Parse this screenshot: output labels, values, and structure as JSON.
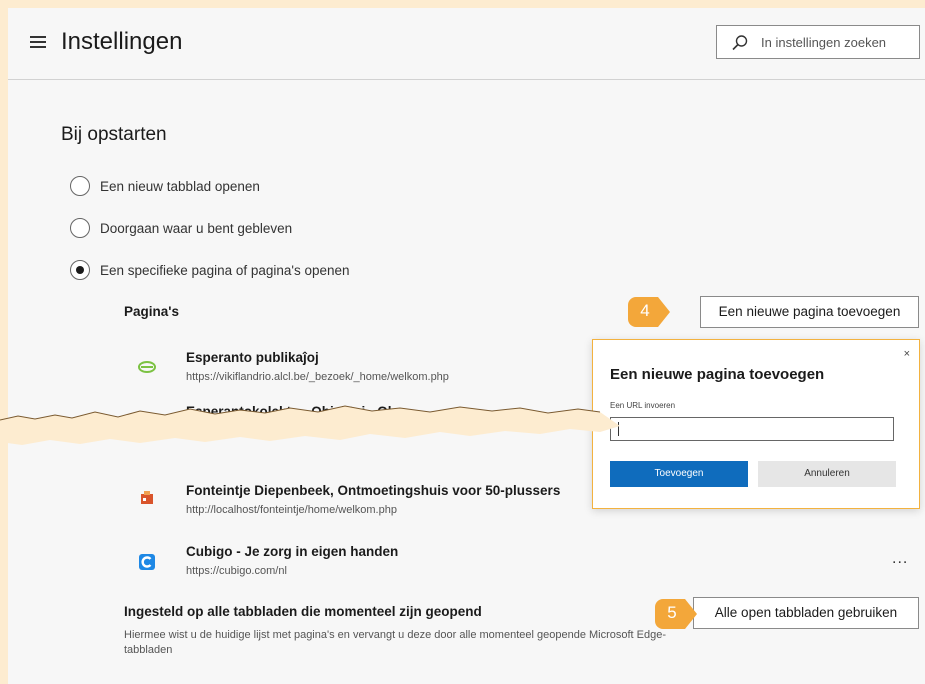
{
  "header": {
    "title": "Instellingen",
    "search_placeholder": "In instellingen zoeken"
  },
  "startup": {
    "heading": "Bij opstarten",
    "options": [
      {
        "label": "Een nieuw tabblad openen",
        "checked": false
      },
      {
        "label": "Doorgaan waar u bent gebleven",
        "checked": false
      },
      {
        "label": "Een specifieke pagina of pagina's openen",
        "checked": true
      }
    ],
    "pages_label": "Pagina's",
    "add_page_button": "Een nieuwe pagina toevoegen",
    "pages": [
      {
        "title": "Esperanto publikaĵoj",
        "url": "https://vikiflandrio.alcl.be/_bezoek/_home/welkom.php",
        "icon": "esperanto-green-icon"
      },
      {
        "title": "Esperantokolekto - Objektoj - Ob",
        "url": "",
        "icon": "torn-hidden"
      },
      {
        "title": "Fonteintje Diepenbeek, Ontmoetingshuis voor 50-plussers",
        "url": "http://localhost/fonteintje/home/welkom.php",
        "icon": "fonteintje-icon"
      },
      {
        "title": "Cubigo - Je zorg in eigen handen",
        "url": "https://cubigo.com/nl",
        "icon": "cubigo-icon"
      }
    ],
    "more_label": "...",
    "all_tabs_title": "Ingesteld op alle tabbladen die momenteel zijn geopend",
    "all_tabs_desc": "Hiermee wist u de huidige lijst met pagina's en vervangt u deze door alle momenteel geopende Microsoft Edge-tabbladen",
    "all_tabs_button": "Alle open tabbladen gebruiken"
  },
  "badges": [
    "4",
    "5"
  ],
  "dialog": {
    "title": "Een nieuwe pagina toevoegen",
    "close": "×",
    "label": "Een URL invoeren",
    "value": "",
    "ok": "Toevoegen",
    "cancel": "Annuleren"
  },
  "colors": {
    "badge": "#f3a73a",
    "primary": "#0f6cbd",
    "paper": "#fdecd0"
  }
}
